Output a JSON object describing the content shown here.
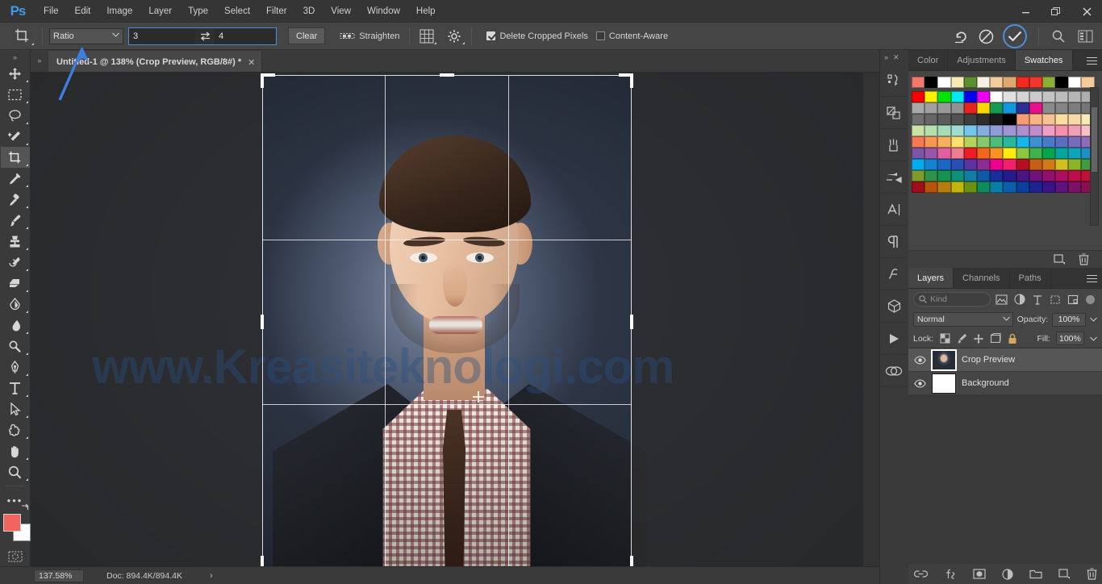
{
  "app": {
    "logo": "Ps"
  },
  "menubar": {
    "items": [
      "File",
      "Edit",
      "Image",
      "Layer",
      "Type",
      "Select",
      "Filter",
      "3D",
      "View",
      "Window",
      "Help"
    ],
    "window_controls": {
      "minimize": "—",
      "restore": "❐",
      "close": "✕"
    }
  },
  "options_bar": {
    "tool_icon": "crop-tool-icon",
    "ratio_mode": "Ratio",
    "ratio_width": "3",
    "ratio_height": "4",
    "swap_label": "⇄",
    "clear_label": "Clear",
    "straighten_label": "Straighten",
    "overlay_icon": "grid-overlay-icon",
    "settings_icon": "gear-icon",
    "delete_cropped_pixels": {
      "label": "Delete Cropped Pixels",
      "checked": true
    },
    "content_aware": {
      "label": "Content-Aware",
      "checked": false
    },
    "reset_icon": "reset-arrow-icon",
    "cancel_icon": "cancel-circle-icon",
    "commit_icon": "commit-check-icon",
    "search_icon": "search-icon",
    "workspace_icon": "workspace-icon"
  },
  "toolbar": {
    "tools": [
      {
        "name": "move-tool",
        "glyph": "move"
      },
      {
        "name": "rectangular-marquee-tool",
        "glyph": "marquee"
      },
      {
        "name": "lasso-tool",
        "glyph": "lasso"
      },
      {
        "name": "quick-selection-tool",
        "glyph": "wand"
      },
      {
        "name": "crop-tool",
        "glyph": "crop",
        "active": true
      },
      {
        "name": "eyedropper-tool",
        "glyph": "eyedropper"
      },
      {
        "name": "spot-healing-brush-tool",
        "glyph": "healing"
      },
      {
        "name": "brush-tool",
        "glyph": "brush"
      },
      {
        "name": "clone-stamp-tool",
        "glyph": "stamp"
      },
      {
        "name": "history-brush-tool",
        "glyph": "historybrush"
      },
      {
        "name": "eraser-tool",
        "glyph": "eraser"
      },
      {
        "name": "gradient-tool",
        "glyph": "gradient"
      },
      {
        "name": "blur-tool",
        "glyph": "blur"
      },
      {
        "name": "dodge-tool",
        "glyph": "dodge"
      },
      {
        "name": "pen-tool",
        "glyph": "pen"
      },
      {
        "name": "horizontal-type-tool",
        "glyph": "type"
      },
      {
        "name": "path-selection-tool",
        "glyph": "arrow"
      },
      {
        "name": "custom-shape-tool",
        "glyph": "shape"
      },
      {
        "name": "hand-tool",
        "glyph": "hand"
      },
      {
        "name": "zoom-tool",
        "glyph": "zoom"
      }
    ],
    "more_tools": "•••",
    "foreground_color": "#f0655d",
    "background_color": "#ffffff",
    "quick_mask": "quick-mask-icon"
  },
  "document": {
    "tab_title": "Untitled-1 @ 138% (Crop Preview, RGB/8#) *",
    "close_glyph": "✕",
    "collapse_glyph": "»",
    "watermark": "www.Kreasiteknologi.com"
  },
  "status_bar": {
    "zoom": "137.58%",
    "doc_info": "Doc: 894.4K/894.4K",
    "expand_glyph": "›"
  },
  "rail": {
    "collapse_glyph": "»",
    "close_glyph": "✕",
    "buttons": [
      {
        "name": "libraries-icon"
      },
      {
        "name": "adjustments-icon"
      },
      {
        "name": "styles-icon"
      },
      {
        "name": "brush-presets-icon"
      },
      {
        "name": "character-icon"
      },
      {
        "name": "paragraph-icon"
      },
      {
        "name": "character-styles-icon"
      },
      {
        "name": "3d-icon"
      },
      {
        "name": "timeline-icon"
      },
      {
        "name": "creative-cloud-icon"
      }
    ]
  },
  "color_panel": {
    "tabs": [
      {
        "label": "Color",
        "active": false
      },
      {
        "label": "Adjustments",
        "active": false
      },
      {
        "label": "Swatches",
        "active": true
      }
    ],
    "menu_icon": "panel-menu-icon",
    "swatch_rows": [
      [
        "#f0786d",
        "#000000",
        "#ffffff",
        "#f7e9b5",
        "#5a9030",
        "#f7efe0",
        "#f3ce9d",
        "#dfa86e",
        "#f32a1c",
        "#f3352b",
        "#8cae33",
        "#000000",
        "#ffffff",
        "#f6cb9b"
      ],
      [
        "#fb0000",
        "#fff000",
        "#00e400",
        "#00e8f0",
        "#0000ef",
        "#ed00ef",
        "#fbfbfb",
        "#e0e0e0",
        "#d4d4d4",
        "#cbcbcb",
        "#c4c4c4",
        "#bdbdbd",
        "#b6b6b6",
        "#aeaeae"
      ],
      [
        "#a8a8a8",
        "#a0a0a0",
        "#999999",
        "#919191",
        "#e8231e",
        "#fbd800",
        "#159a52",
        "#1398e0",
        "#2a2f92",
        "#ea0f8a",
        "#8a8a8a",
        "#848484",
        "#7d7d7d",
        "#767676"
      ],
      [
        "#6f6f6f",
        "#666666",
        "#5c5c5c",
        "#525252",
        "#3e3e3e",
        "#2e2e2e",
        "#1c1c1c",
        "#000000",
        "#f79c72",
        "#f6b383",
        "#f5c393",
        "#fade9e",
        "#f8d9a8",
        "#f6e9b6"
      ],
      [
        "#cbe2a6",
        "#b6dfae",
        "#a5dcb9",
        "#9fdcd0",
        "#74c6ee",
        "#86adde",
        "#8f9cd8",
        "#9f95d4",
        "#ae8fd0",
        "#c18ccb",
        "#ef9fc6",
        "#f48fae",
        "#f0a0b4",
        "#f6c1c6"
      ],
      [
        "#f47a55",
        "#f79754",
        "#f9b05e",
        "#fbe06f",
        "#b4d45b",
        "#86c96d",
        "#4dbd7e",
        "#2ab79b",
        "#18b6e6",
        "#3f8fd5",
        "#4a7bc9",
        "#5b6fc0",
        "#7a6bbd",
        "#8f6bba"
      ],
      [
        "#7b56a8",
        "#9a54a8",
        "#e0609f",
        "#ef7f8f",
        "#ee1c24",
        "#f4661c",
        "#f79420",
        "#fdeb0b",
        "#8dc63f",
        "#3eb34a",
        "#00a650",
        "#00a79c",
        "#0fa4bb",
        "#1f8fc7"
      ],
      [
        "#00aeef",
        "#1282d0",
        "#1a68c4",
        "#2a4fb2",
        "#5c34a0",
        "#8b2d94",
        "#ec008c",
        "#f0206a",
        "#b50f22",
        "#c95d13",
        "#d4791a",
        "#cfc020",
        "#8db327",
        "#3f9e3c"
      ],
      [
        "#7f9b2d",
        "#2f9248",
        "#18924f",
        "#119078",
        "#0f7fa5",
        "#1159a8",
        "#172f9b",
        "#241b8c",
        "#4a1583",
        "#6d1379",
        "#90116d",
        "#ac0f5e",
        "#bb0f4a",
        "#c10f35"
      ],
      [
        "#9d0f18",
        "#b7540b",
        "#b77e0c",
        "#c2b60e",
        "#6c9110",
        "#0e8c5b",
        "#0b7ea6",
        "#0b5ea8",
        "#0b3f9e",
        "#1b2490",
        "#3a1486",
        "#5d1379",
        "#7c1168",
        "#8d0f52"
      ]
    ],
    "footer_icons": [
      "new-swatch-icon",
      "delete-swatch-icon"
    ],
    "scrollbar": "swatches-scrollbar"
  },
  "layers_panel": {
    "tabs": [
      {
        "label": "Layers",
        "active": true
      },
      {
        "label": "Channels",
        "active": false
      },
      {
        "label": "Paths",
        "active": false
      }
    ],
    "menu_icon": "panel-menu-icon",
    "filter_placeholder": "Kind",
    "filter_icons": [
      "filter-pixel-icon",
      "filter-adjustment-icon",
      "filter-type-icon",
      "filter-shape-icon",
      "filter-smart-object-icon"
    ],
    "filter_toggle": "filter-enable-toggle",
    "blend_mode": "Normal",
    "opacity_label": "Opacity:",
    "opacity_value": "100%",
    "lock_label": "Lock:",
    "lock_icons": [
      "lock-transparent-icon",
      "lock-image-icon",
      "lock-position-icon",
      "lock-artboard-icon",
      "lock-all-icon"
    ],
    "fill_label": "Fill:",
    "fill_value": "100%",
    "layers": [
      {
        "name": "Crop Preview",
        "visible": true,
        "selected": true,
        "thumb": "photo"
      },
      {
        "name": "Background",
        "visible": true,
        "selected": false,
        "thumb": "white"
      }
    ],
    "footer_icons": [
      "link-layers-icon",
      "layer-style-fx-icon",
      "add-layer-mask-icon",
      "new-adjustment-layer-icon",
      "new-group-icon",
      "new-layer-icon",
      "delete-layer-icon"
    ]
  }
}
